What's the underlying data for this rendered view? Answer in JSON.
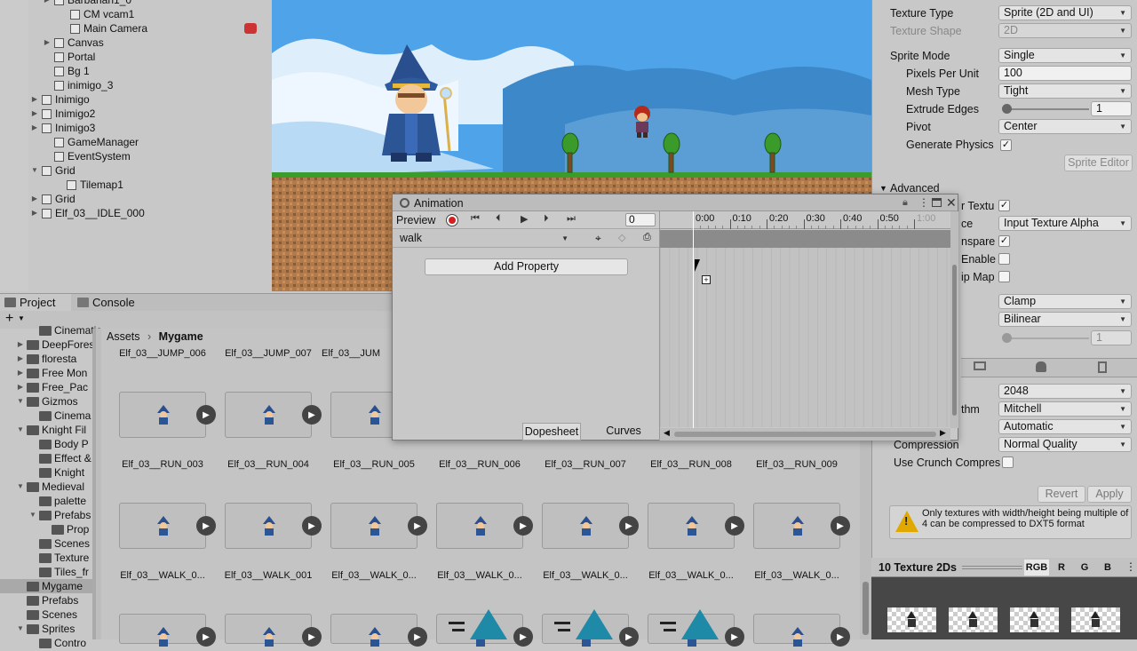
{
  "hierarchy": {
    "items": [
      {
        "label": "Barbarian1_0",
        "arrow": "▶"
      },
      {
        "label": "CM vcam1",
        "arrow": ""
      },
      {
        "label": "Main Camera",
        "arrow": ""
      },
      {
        "label": "Canvas",
        "arrow": "▶"
      },
      {
        "label": "Portal",
        "arrow": ""
      },
      {
        "label": "Bg 1",
        "arrow": ""
      },
      {
        "label": "inimigo_3",
        "arrow": ""
      },
      {
        "label": "Inimigo",
        "arrow": "▶"
      },
      {
        "label": "Inimigo2",
        "arrow": "▶"
      },
      {
        "label": "Inimigo3",
        "arrow": "▶"
      },
      {
        "label": "GameManager",
        "arrow": ""
      },
      {
        "label": "EventSystem",
        "arrow": ""
      },
      {
        "label": "Grid",
        "arrow": "▼"
      },
      {
        "label": "Tilemap1",
        "arrow": ""
      },
      {
        "label": "Grid",
        "arrow": "▶"
      },
      {
        "label": "Elf_03__IDLE_000",
        "arrow": "▶"
      }
    ]
  },
  "project": {
    "tab_project": "Project",
    "tab_console": "Console",
    "add_label": "+",
    "breadcrumb_root": "Assets",
    "breadcrumb_current": "Mygame",
    "folders": [
      {
        "label": "Cinematic",
        "arrow": "",
        "indent": 2
      },
      {
        "label": "DeepForest",
        "arrow": "▶",
        "indent": 1
      },
      {
        "label": "floresta",
        "arrow": "▶",
        "indent": 1
      },
      {
        "label": "Free Mon",
        "arrow": "▶",
        "indent": 1
      },
      {
        "label": "Free_Pac",
        "arrow": "▶",
        "indent": 1
      },
      {
        "label": "Gizmos",
        "arrow": "▼",
        "indent": 1
      },
      {
        "label": "Cinema",
        "arrow": "",
        "indent": 2
      },
      {
        "label": "Knight Fil",
        "arrow": "▼",
        "indent": 1
      },
      {
        "label": "Body P",
        "arrow": "",
        "indent": 2
      },
      {
        "label": "Effect &",
        "arrow": "",
        "indent": 2
      },
      {
        "label": "Knight",
        "arrow": "",
        "indent": 2
      },
      {
        "label": "Medieval",
        "arrow": "▼",
        "indent": 1
      },
      {
        "label": "palette",
        "arrow": "",
        "indent": 2
      },
      {
        "label": "Prefabs",
        "arrow": "▼",
        "indent": 2
      },
      {
        "label": "Prop",
        "arrow": "",
        "indent": 3
      },
      {
        "label": "Scenes",
        "arrow": "",
        "indent": 2
      },
      {
        "label": "Texture",
        "arrow": "",
        "indent": 2
      },
      {
        "label": "Tiles_fr",
        "arrow": "",
        "indent": 2
      },
      {
        "label": "Mygame",
        "arrow": "",
        "indent": 1
      },
      {
        "label": "Prefabs",
        "arrow": "",
        "indent": 1
      },
      {
        "label": "Scenes",
        "arrow": "",
        "indent": 1
      },
      {
        "label": "Sprites",
        "arrow": "▼",
        "indent": 1
      },
      {
        "label": "Contro",
        "arrow": "",
        "indent": 2
      }
    ],
    "top_labels": [
      "Elf_03__JUMP_006",
      "Elf_03__JUMP_007",
      "Elf_03__JUMP"
    ],
    "row2_labels": [
      "Elf_03__RUN_003",
      "Elf_03__RUN_004",
      "Elf_03__RUN_005",
      "Elf_03__RUN_006",
      "Elf_03__RUN_007",
      "Elf_03__RUN_008",
      "Elf_03__RUN_009"
    ],
    "row3_labels": [
      "Elf_03__WALK_0...",
      "Elf_03__WALK_001",
      "Elf_03__WALK_0...",
      "Elf_03__WALK_0...",
      "Elf_03__WALK_0...",
      "Elf_03__WALK_0...",
      "Elf_03__WALK_0..."
    ]
  },
  "animation": {
    "title": "Animation",
    "preview": "Preview",
    "frame": "0",
    "clip": "walk",
    "add_property": "Add Property",
    "dopesheet": "Dopesheet",
    "curves": "Curves",
    "ticks": [
      "0:00",
      "0:10",
      "0:20",
      "0:30",
      "0:40",
      "0:50",
      "1:00"
    ]
  },
  "inspector": {
    "texture_type_label": "Texture Type",
    "texture_type": "Sprite (2D and UI)",
    "texture_shape_label": "Texture Shape",
    "texture_shape": "2D",
    "sprite_mode_label": "Sprite Mode",
    "sprite_mode": "Single",
    "ppu_label": "Pixels Per Unit",
    "ppu": "100",
    "mesh_type_label": "Mesh Type",
    "mesh_type": "Tight",
    "extrude_label": "Extrude Edges",
    "extrude": "1",
    "pivot_label": "Pivot",
    "pivot": "Center",
    "gen_physics_label": "Generate Physics S",
    "sprite_editor": "Sprite Editor",
    "advanced_label": "Advanced",
    "srgb_label": "r Textu",
    "alpha_source_label": "ce",
    "alpha_source": "Input Texture Alpha",
    "alpha_transparency_label": "nspare",
    "readwrite_label": "Enable",
    "mipmap_label": "ip Map",
    "wrap": "Clamp",
    "filter": "Bilinear",
    "aniso": "1",
    "max_size": "2048",
    "resize_label": "thm",
    "resize": "Mitchell",
    "format": "Automatic",
    "compression_label": "Compression",
    "compression": "Normal Quality",
    "crunch_label": "Use Crunch Compres",
    "revert": "Revert",
    "apply": "Apply",
    "warning": "Only textures with width/height being multiple of 4 can be compressed to DXT5 format",
    "preview_title": "10 Texture 2Ds",
    "channels": [
      "RGB",
      "R",
      "G",
      "B"
    ]
  }
}
